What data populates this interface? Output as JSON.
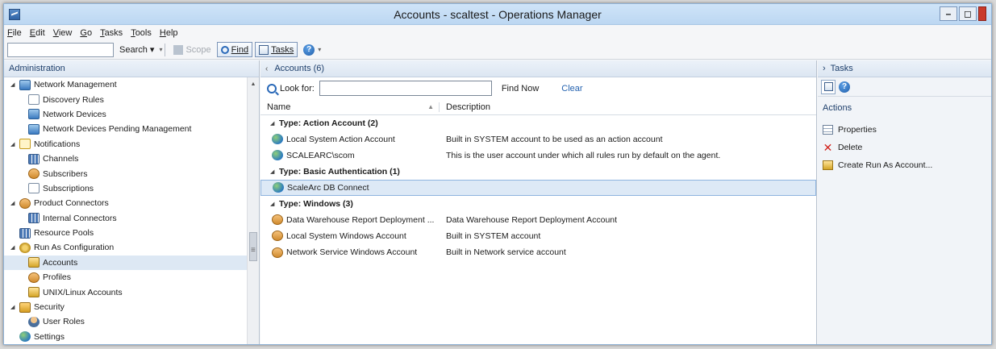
{
  "window": {
    "title": "Accounts - scaltest - Operations Manager",
    "min": "–",
    "max": "◻"
  },
  "menu": [
    "File",
    "Edit",
    "View",
    "Go",
    "Tasks",
    "Tools",
    "Help"
  ],
  "toolbar": {
    "search": "Search",
    "scope": "Scope",
    "find": "Find",
    "tasks": "Tasks",
    "overflow": "▾"
  },
  "left": {
    "header": "Administration",
    "tree": [
      {
        "label": "Network Management",
        "indent": 0,
        "expander": "◢",
        "icon": "net"
      },
      {
        "label": "Discovery Rules",
        "indent": 1,
        "expander": "",
        "icon": "doc"
      },
      {
        "label": "Network Devices",
        "indent": 1,
        "expander": "",
        "icon": "net"
      },
      {
        "label": "Network Devices Pending Management",
        "indent": 1,
        "expander": "",
        "icon": "net"
      },
      {
        "label": "Notifications",
        "indent": 0,
        "expander": "◢",
        "icon": "mail"
      },
      {
        "label": "Channels",
        "indent": 1,
        "expander": "",
        "icon": "grid"
      },
      {
        "label": "Subscribers",
        "indent": 1,
        "expander": "",
        "icon": "people"
      },
      {
        "label": "Subscriptions",
        "indent": 1,
        "expander": "",
        "icon": "doc"
      },
      {
        "label": "Product Connectors",
        "indent": 0,
        "expander": "◢",
        "icon": "people"
      },
      {
        "label": "Internal Connectors",
        "indent": 1,
        "expander": "",
        "icon": "grid"
      },
      {
        "label": "Resource Pools",
        "indent": 0,
        "expander": "",
        "icon": "grid"
      },
      {
        "label": "Run As Configuration",
        "indent": 0,
        "expander": "◢",
        "icon": "gear"
      },
      {
        "label": "Accounts",
        "indent": 1,
        "expander": "",
        "icon": "key",
        "selected": true
      },
      {
        "label": "Profiles",
        "indent": 1,
        "expander": "",
        "icon": "people"
      },
      {
        "label": "UNIX/Linux Accounts",
        "indent": 1,
        "expander": "",
        "icon": "key"
      },
      {
        "label": "Security",
        "indent": 0,
        "expander": "◢",
        "icon": "lock"
      },
      {
        "label": "User Roles",
        "indent": 1,
        "expander": "",
        "icon": "user"
      },
      {
        "label": "Settings",
        "indent": 0,
        "expander": "",
        "icon": "globe"
      }
    ]
  },
  "center": {
    "header": "Accounts (6)",
    "look_for_label": "Look for:",
    "look_for_value": "",
    "find_now": "Find Now",
    "clear": "Clear",
    "col_name": "Name",
    "col_desc": "Description",
    "groups": [
      {
        "title": "Type: Action Account (2)",
        "rows": [
          {
            "name": "Local System Action Account",
            "desc": "Built in SYSTEM account to be used as an action account",
            "icon": "globe"
          },
          {
            "name": "SCALEARC\\scom",
            "desc": "This is the user account under which all rules run by default on the agent.",
            "icon": "globe"
          }
        ]
      },
      {
        "title": "Type: Basic Authentication (1)",
        "rows": [
          {
            "name": "ScaleArc DB Connect",
            "desc": "",
            "icon": "globe",
            "selected": true
          }
        ]
      },
      {
        "title": "Type: Windows (3)",
        "rows": [
          {
            "name": "Data Warehouse Report Deployment ...",
            "desc": "Data Warehouse Report Deployment Account",
            "icon": "people"
          },
          {
            "name": "Local System Windows Account",
            "desc": "Built in SYSTEM account",
            "icon": "people"
          },
          {
            "name": "Network Service Windows Account",
            "desc": "Built in Network service account",
            "icon": "people"
          }
        ]
      }
    ]
  },
  "right": {
    "header": "Tasks",
    "actions_title": "Actions",
    "actions": [
      {
        "label": "Properties",
        "icon": "props"
      },
      {
        "label": "Delete",
        "icon": "del"
      },
      {
        "label": "Create Run As Account...",
        "icon": "create"
      }
    ]
  }
}
